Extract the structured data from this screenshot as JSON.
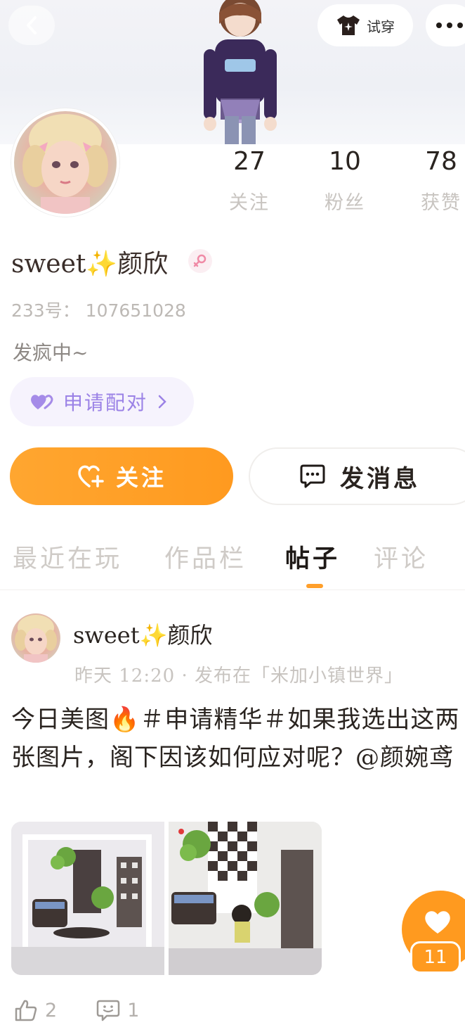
{
  "header": {
    "back_icon": "chevron-left-icon",
    "tryon_label": "试穿",
    "tryon_icon": "shirt-sparkle-icon",
    "more_icon": "more-dots-icon"
  },
  "profile": {
    "stats": [
      {
        "value": "27",
        "label": "关注"
      },
      {
        "value": "10",
        "label": "粉丝"
      },
      {
        "value": "78",
        "label": "获赞"
      }
    ],
    "nickname": "sweet✨颜欣",
    "gender_icon": "female-icon",
    "uid": "233号： 107651028",
    "bio": "发疯中~",
    "pair_button": "申请配对",
    "follow_button": "关注",
    "message_button": "发消息"
  },
  "tabs": [
    {
      "label": "最近在玩",
      "active": false
    },
    {
      "label": "作品栏",
      "active": false
    },
    {
      "label": "帖子",
      "active": true
    },
    {
      "label": "评论",
      "active": false
    }
  ],
  "post": {
    "author": "sweet✨颜欣",
    "meta": "昨天  12:20 · 发布在「米加小镇世界」",
    "text": "今日美图🔥＃申请精华＃如果我选出这两张图片，阁下因该如何应对呢？@颜婉鸢",
    "likes": "2",
    "comments": "1"
  },
  "floating_like": {
    "count": "11"
  },
  "colors": {
    "accent_orange": "#ff9f2a",
    "pair_purple": "#9b82e6",
    "muted_text": "#c8c4c0"
  }
}
